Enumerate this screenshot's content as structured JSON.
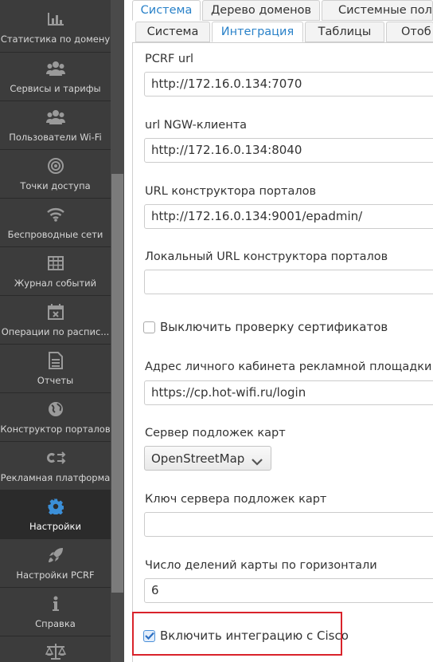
{
  "sidebar": {
    "items": [
      {
        "label": "Статистика по домену",
        "icon": "bar-chart-icon"
      },
      {
        "label": "Сервисы и тарифы",
        "icon": "users-icon"
      },
      {
        "label": "Пользователи Wi-Fi",
        "icon": "users-icon"
      },
      {
        "label": "Точки доступа",
        "icon": "target-icon"
      },
      {
        "label": "Беспроводные сети",
        "icon": "wifi-icon"
      },
      {
        "label": "Журнал событий",
        "icon": "table-icon"
      },
      {
        "label": "Операции по расписанию",
        "display": "Операции по распис...",
        "icon": "calendar-icon"
      },
      {
        "label": "Отчеты",
        "icon": "document-icon"
      },
      {
        "label": "Конструктор порталов",
        "icon": "globe-icon"
      },
      {
        "label": "Рекламная платформа",
        "icon": "ad-platform-icon"
      },
      {
        "label": "Настройки",
        "icon": "gear-icon",
        "active": true
      },
      {
        "label": "Настройки PCRF",
        "icon": "rocket-icon"
      },
      {
        "label": "Справка",
        "icon": "info-icon"
      },
      {
        "label": "",
        "icon": "scales-icon"
      }
    ]
  },
  "tabs": {
    "row1": [
      "Система",
      "Дерево доменов",
      "Системные поль..."
    ],
    "row2": [
      "Система",
      "Интеграция",
      "Таблицы",
      "Отоб"
    ],
    "active_row1": 0,
    "active_row2": 1
  },
  "form": {
    "pcrf_label": "PCRF url",
    "pcrf_value": "http://172.16.0.134:7070",
    "ngw_label": "url NGW-клиента",
    "ngw_value": "http://172.16.0.134:8040",
    "portal_label": "URL конструктора порталов",
    "portal_value": "http://172.16.0.134:9001/epadmin/",
    "local_portal_label": "Локальный URL конструктора порталов",
    "local_portal_value": "",
    "disable_cert_label": "Выключить проверку сертификатов",
    "disable_cert_checked": false,
    "ad_cabinet_label": "Адрес личного кабинета рекламной площадки",
    "ad_cabinet_value": "https://cp.hot-wifi.ru/login",
    "map_server_label": "Сервер подложек карт",
    "map_server_value": "OpenStreetMap",
    "map_key_label": "Ключ сервера подложек карт",
    "map_key_value": "",
    "grid_label": "Число делений карты по горизонтали",
    "grid_value": "6",
    "cisco_label": "Включить интеграцию с Cisco",
    "cisco_checked": true
  },
  "colors": {
    "sidebar_bg": "#3c3c3c",
    "active_icon": "#3b8fd8",
    "accent_tab": "#2a82c9",
    "highlight": "#d9232b"
  }
}
